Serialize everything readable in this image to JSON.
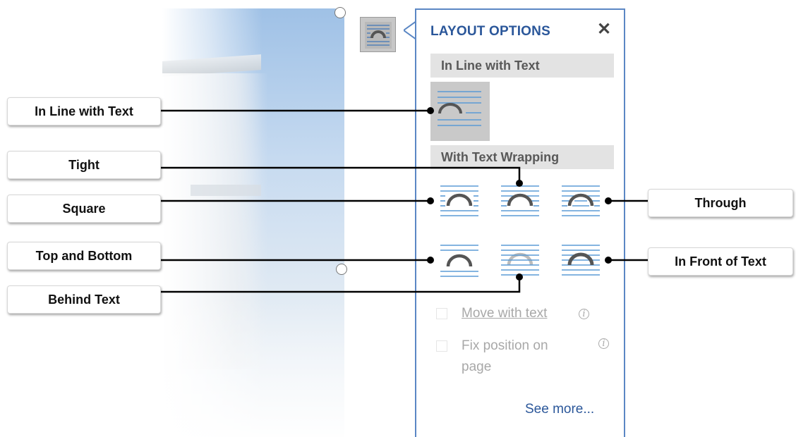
{
  "panel": {
    "title": "LAYOUT OPTIONS",
    "close_symbol": "✕",
    "section_inline": "In Line with Text",
    "section_wrapping": "With Text Wrapping",
    "options": [
      {
        "name": "in-line-with-text",
        "icon": "inline-wrap-icon",
        "selected": true
      },
      {
        "name": "square",
        "icon": "square-wrap-icon",
        "selected": false
      },
      {
        "name": "tight",
        "icon": "tight-wrap-icon",
        "selected": false
      },
      {
        "name": "through",
        "icon": "through-wrap-icon",
        "selected": false
      },
      {
        "name": "top-and-bottom",
        "icon": "top-bottom-wrap-icon",
        "selected": false
      },
      {
        "name": "behind-text",
        "icon": "behind-text-icon",
        "selected": false
      },
      {
        "name": "in-front-of-text",
        "icon": "in-front-text-icon",
        "selected": false
      }
    ],
    "move_with_text": "Move with text",
    "fix_position_line1": "Fix position on",
    "fix_position_line2": "page",
    "info_symbol": "i",
    "see_more": "See more..."
  },
  "callouts": {
    "in_line_with_text": "In Line with Text",
    "tight": "Tight",
    "square": "Square",
    "top_and_bottom": "Top and Bottom",
    "behind_text": "Behind Text",
    "through": "Through",
    "in_front_of_text": "In Front of Text"
  },
  "colors": {
    "accent": "#2b579a",
    "panel_border": "#5b87c4",
    "icon_line": "#5b9bd5",
    "icon_arch": "#555555"
  }
}
